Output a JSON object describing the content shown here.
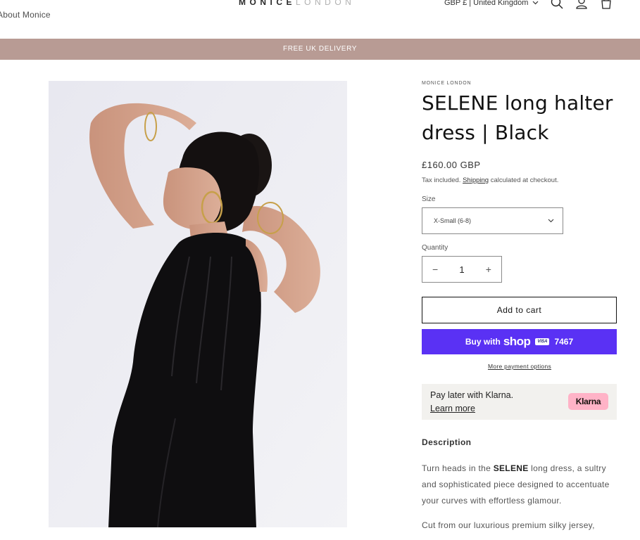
{
  "header": {
    "nav_about": "About Monice",
    "logo_part1": "MONICE",
    "logo_part2": "LONDON",
    "locale": "GBP £ | United Kingdom"
  },
  "announcement": "FREE UK DELIVERY",
  "product": {
    "vendor": "MONICE LONDON",
    "title": "SELENE long halter dress | Black",
    "price": "£160.00 GBP",
    "tax_prefix": "Tax included.",
    "tax_link": "Shipping",
    "tax_suffix": "calculated at checkout.",
    "size_label": "Size",
    "size_value": "X-Small (6-8)",
    "quantity_label": "Quantity",
    "quantity_value": "1",
    "add_to_cart": "Add to cart",
    "shop_pay": {
      "buy_with": "Buy with",
      "shop": "shop",
      "card_brand": "VISA",
      "card_last4": "7467"
    },
    "more_payment": "More payment options",
    "klarna": {
      "text": "Pay later with Klarna.",
      "learn_more": "Learn more",
      "badge": "Klarna"
    },
    "description_heading": "Description",
    "description_1_prefix": "Turn heads in the",
    "description_1_bold": "SELENE",
    "description_1_suffix": "long dress, a sultry and sophisticated piece designed to accentuate your curves with effortless glamour.",
    "description_2": "Cut from our luxurious premium silky jersey,"
  },
  "colors": {
    "announcement_bg": "#b89b94",
    "shop_pay_bg": "#5a31f4",
    "klarna_badge": "#ffb3c7",
    "klarna_bg": "#f2f1ee"
  }
}
